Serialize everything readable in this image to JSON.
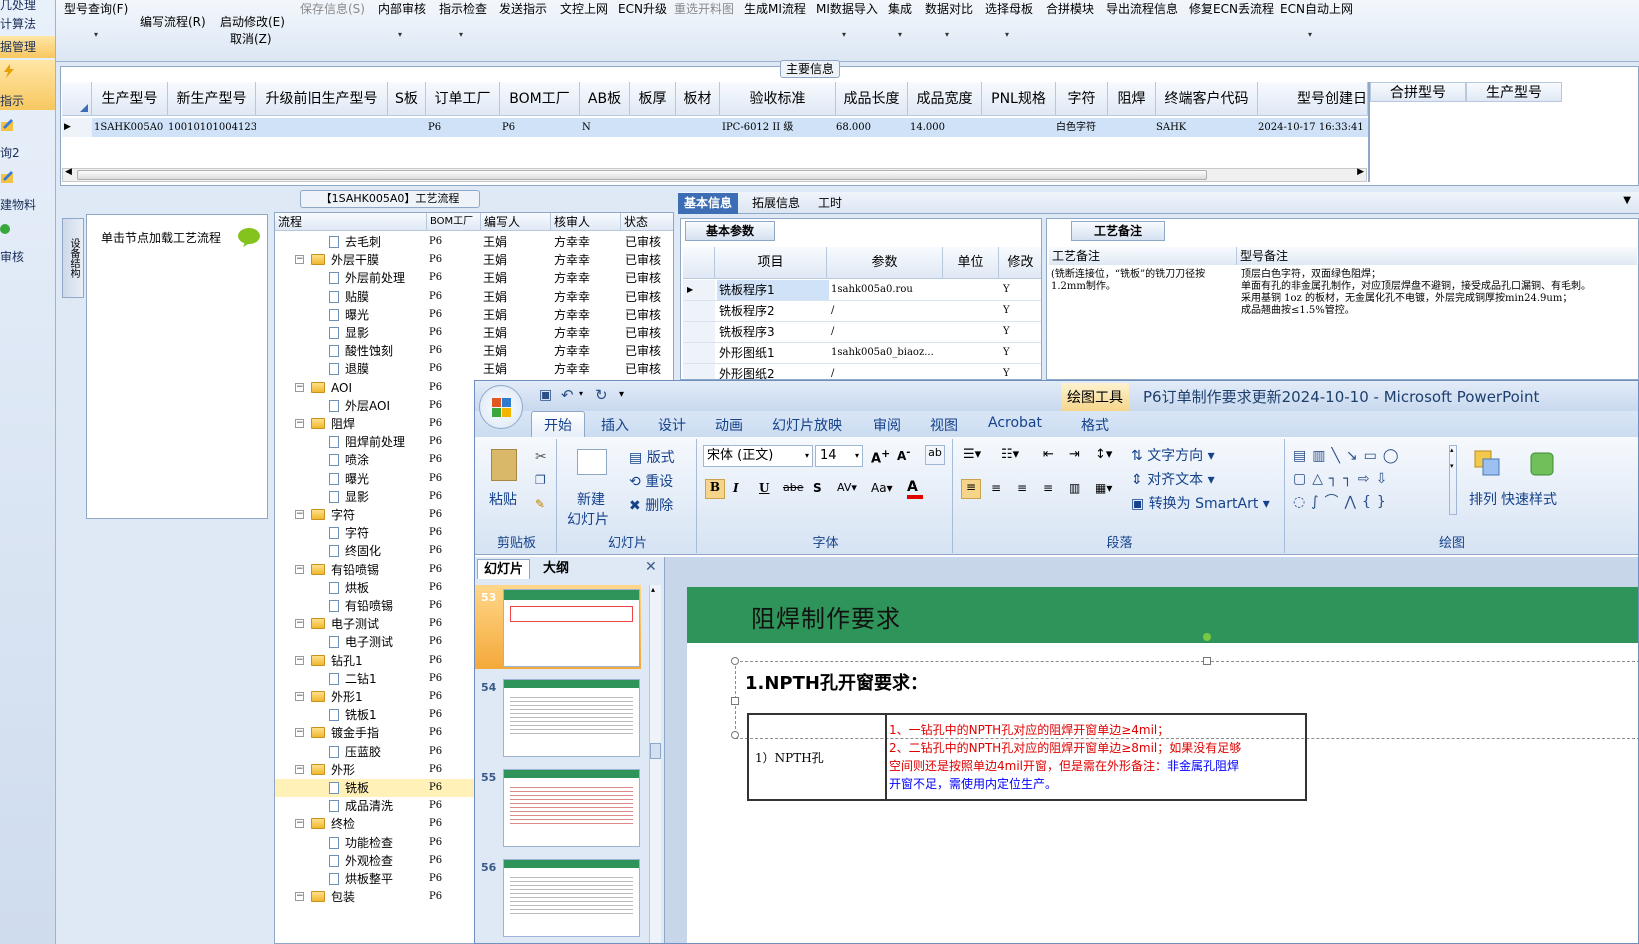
{
  "leftnav": {
    "items": [
      "几处理",
      "计算法",
      "据管理",
      "指示",
      "询2",
      "建物料",
      "审核"
    ]
  },
  "toolbar": {
    "buttons": [
      "型号查询(F)",
      "编写流程(R)",
      "启动修改(E)",
      "取消(Z)",
      "保存信息(S)",
      "内部审核",
      "指示检查",
      "发送指示",
      "文控上网",
      "ECN升级",
      "重选开料图",
      "生成MI流程",
      "MI数据导入",
      "集成",
      "数据对比",
      "选择母板",
      "合拼模块",
      "导出流程信息",
      "修复ECN丢流程",
      "ECN自动上网"
    ]
  },
  "maininfo": {
    "caption": "主要信息",
    "headers": [
      "生产型号",
      "新生产型号",
      "升级前旧生产型号",
      "S板",
      "订单工厂",
      "BOM工厂",
      "AB板",
      "板厚",
      "板材",
      "验收标准",
      "成品长度",
      "成品宽度",
      "PNL规格",
      "字符",
      "阻焊",
      "终端客户代码",
      "型号创建日"
    ],
    "row": [
      "1SAHK005A0",
      "10010101004123",
      "",
      "",
      "P6",
      "P6",
      "N",
      "",
      "",
      "IPC-6012 II 级",
      "68.000",
      "14.000",
      "",
      "白色字符",
      "",
      "SAHK",
      "2024-10-17 16:33:41"
    ],
    "side_headers": [
      "合拼型号",
      "生产型号"
    ]
  },
  "process": {
    "caption": "【1SAHK005A0】工艺流程",
    "vertical_tab": "设备结构",
    "node_hint": "单击节点加载工艺流程",
    "headers": [
      "流程",
      "BOM工厂",
      "编写人",
      "核审人",
      "状态"
    ],
    "rows": [
      {
        "name": "去毛刺",
        "level": 2,
        "bom": "P6",
        "writer": "王娟",
        "reviewer": "方幸幸",
        "status": "已审核"
      },
      {
        "name": "外层干膜",
        "level": 1,
        "bom": "P6",
        "writer": "王娟",
        "reviewer": "方幸幸",
        "status": "已审核"
      },
      {
        "name": "外层前处理",
        "level": 2,
        "bom": "P6",
        "writer": "王娟",
        "reviewer": "方幸幸",
        "status": "已审核"
      },
      {
        "name": "贴膜",
        "level": 2,
        "bom": "P6",
        "writer": "王娟",
        "reviewer": "方幸幸",
        "status": "已审核"
      },
      {
        "name": "曝光",
        "level": 2,
        "bom": "P6",
        "writer": "王娟",
        "reviewer": "方幸幸",
        "status": "已审核"
      },
      {
        "name": "显影",
        "level": 2,
        "bom": "P6",
        "writer": "王娟",
        "reviewer": "方幸幸",
        "status": "已审核"
      },
      {
        "name": "酸性蚀刻",
        "level": 2,
        "bom": "P6",
        "writer": "王娟",
        "reviewer": "方幸幸",
        "status": "已审核"
      },
      {
        "name": "退膜",
        "level": 2,
        "bom": "P6",
        "writer": "王娟",
        "reviewer": "方幸幸",
        "status": "已审核"
      },
      {
        "name": "AOI",
        "level": 1,
        "bom": "P6",
        "writer": "",
        "reviewer": "",
        "status": ""
      },
      {
        "name": "外层AOI",
        "level": 2,
        "bom": "P6",
        "writer": "",
        "reviewer": "",
        "status": ""
      },
      {
        "name": "阻焊",
        "level": 1,
        "bom": "P6",
        "writer": "",
        "reviewer": "",
        "status": ""
      },
      {
        "name": "阻焊前处理",
        "level": 2,
        "bom": "P6",
        "writer": "",
        "reviewer": "",
        "status": ""
      },
      {
        "name": "喷涂",
        "level": 2,
        "bom": "P6",
        "writer": "",
        "reviewer": "",
        "status": ""
      },
      {
        "name": "曝光",
        "level": 2,
        "bom": "P6",
        "writer": "",
        "reviewer": "",
        "status": ""
      },
      {
        "name": "显影",
        "level": 2,
        "bom": "P6",
        "writer": "",
        "reviewer": "",
        "status": ""
      },
      {
        "name": "字符",
        "level": 1,
        "bom": "P6",
        "writer": "",
        "reviewer": "",
        "status": ""
      },
      {
        "name": "字符",
        "level": 2,
        "bom": "P6",
        "writer": "",
        "reviewer": "",
        "status": ""
      },
      {
        "name": "终固化",
        "level": 2,
        "bom": "P6",
        "writer": "",
        "reviewer": "",
        "status": ""
      },
      {
        "name": "有铅喷锡",
        "level": 1,
        "bom": "P6",
        "writer": "",
        "reviewer": "",
        "status": ""
      },
      {
        "name": "烘板",
        "level": 2,
        "bom": "P6",
        "writer": "",
        "reviewer": "",
        "status": ""
      },
      {
        "name": "有铅喷锡",
        "level": 2,
        "bom": "P6",
        "writer": "",
        "reviewer": "",
        "status": ""
      },
      {
        "name": "电子测试",
        "level": 1,
        "bom": "P6",
        "writer": "",
        "reviewer": "",
        "status": ""
      },
      {
        "name": "电子测试",
        "level": 2,
        "bom": "P6",
        "writer": "",
        "reviewer": "",
        "status": ""
      },
      {
        "name": "钻孔1",
        "level": 1,
        "bom": "P6",
        "writer": "",
        "reviewer": "",
        "status": ""
      },
      {
        "name": "二钻1",
        "level": 2,
        "bom": "P6",
        "writer": "",
        "reviewer": "",
        "status": ""
      },
      {
        "name": "外形1",
        "level": 1,
        "bom": "P6",
        "writer": "",
        "reviewer": "",
        "status": ""
      },
      {
        "name": "铣板1",
        "level": 2,
        "bom": "P6",
        "writer": "",
        "reviewer": "",
        "status": ""
      },
      {
        "name": "镀金手指",
        "level": 1,
        "bom": "P6",
        "writer": "",
        "reviewer": "",
        "status": ""
      },
      {
        "name": "压蓝胶",
        "level": 2,
        "bom": "P6",
        "writer": "",
        "reviewer": "",
        "status": ""
      },
      {
        "name": "外形",
        "level": 1,
        "bom": "P6",
        "writer": "",
        "reviewer": "",
        "status": ""
      },
      {
        "name": "铣板",
        "level": 2,
        "bom": "P6",
        "writer": "",
        "reviewer": "",
        "status": "",
        "selected": true
      },
      {
        "name": "成品清洗",
        "level": 2,
        "bom": "P6",
        "writer": "",
        "reviewer": "",
        "status": ""
      },
      {
        "name": "终检",
        "level": 1,
        "bom": "P6",
        "writer": "",
        "reviewer": "",
        "status": ""
      },
      {
        "name": "功能检查",
        "level": 2,
        "bom": "P6",
        "writer": "",
        "reviewer": "",
        "status": ""
      },
      {
        "name": "外观检查",
        "level": 2,
        "bom": "P6",
        "writer": "",
        "reviewer": "",
        "status": ""
      },
      {
        "name": "烘板整平",
        "level": 2,
        "bom": "P6",
        "writer": "",
        "reviewer": "",
        "status": ""
      },
      {
        "name": "包装",
        "level": 1,
        "bom": "P6",
        "writer": "",
        "reviewer": "",
        "status": ""
      }
    ]
  },
  "info": {
    "tabs": [
      "基本信息",
      "拓展信息",
      "工时"
    ],
    "basic_caption": "基本参数",
    "basic_headers": [
      "项目",
      "参数",
      "单位",
      "修改"
    ],
    "basic_rows": [
      {
        "item": "铣板程序1",
        "param": "1sahk005a0.rou",
        "unit": "",
        "flag": "Y"
      },
      {
        "item": "铣板程序2",
        "param": "/",
        "unit": "",
        "flag": "Y"
      },
      {
        "item": "铣板程序3",
        "param": "/",
        "unit": "",
        "flag": "Y"
      },
      {
        "item": "外形图纸1",
        "param": "1sahk005a0_biaoz...",
        "unit": "",
        "flag": "Y"
      },
      {
        "item": "外形图纸2",
        "param": "/",
        "unit": "",
        "flag": "Y"
      }
    ],
    "notes_caption": "工艺备注",
    "notes_headers": [
      "工艺备注",
      "型号备注"
    ],
    "process_note": "(铣断连接位，“铣板”的铣刀刀径按1.2mm制作。",
    "model_note": "顶层白色字符，双面绿色阻焊；\n单面有孔的非金属孔制作，对应顶层焊盘不避铜，接受成品孔口漏铜、有毛刺。\n采用基铜 1oz 的板材，无金属化孔不电镀，外层完成铜厚按min24.9um；\n成品翘曲按≤1.5%管控。"
  },
  "ppt": {
    "tools_label": "绘图工具",
    "title": "P6订单制作要求更新2024-10-10 - Microsoft PowerPoint",
    "tabs": [
      "开始",
      "插入",
      "设计",
      "动画",
      "幻灯片放映",
      "审阅",
      "视图",
      "Acrobat",
      "格式"
    ],
    "clipboard": {
      "paste": "粘贴",
      "label": "剪贴板"
    },
    "slides_group": {
      "new": "新建",
      "new2": "幻灯片",
      "layout": "版式",
      "reset": "重设",
      "delete": "删除",
      "label": "幻灯片"
    },
    "font": {
      "name": "宋体 (正文)",
      "size": "14",
      "label": "字体"
    },
    "paragraph": {
      "direction": "文字方向",
      "align": "对齐文本",
      "smartart": "转换为 SmartArt",
      "label": "段落"
    },
    "drawing": {
      "arrange": "排列",
      "quick": "快速样式",
      "label": "绘图"
    },
    "pane_tabs": [
      "幻灯片",
      "大纲"
    ],
    "thumb_numbers": [
      "53",
      "54",
      "55",
      "56"
    ],
    "slide": {
      "title": "阻焊制作要求",
      "heading": "1.NPTH孔开窗要求：",
      "cell_label": "1）NPTH孔",
      "line1": "1、一钻孔中的NPTH孔对应的阻焊开窗单边≥4mil；",
      "line2a": "2、二钻孔中的NPTH孔对应的阻焊开窗单边≥8mil；如果没有足够",
      "line2b": "空间则还是按照单边4mil开窗，但是需在外形备注：",
      "line2c": "非金属孔阻焊",
      "line3": "开窗不足，需使用内定位生产。"
    }
  },
  "colors": {
    "accent": "#3d6db4",
    "slide_band": "#2e9459",
    "red_text": "#e00000",
    "blue_text": "#0000ff"
  }
}
